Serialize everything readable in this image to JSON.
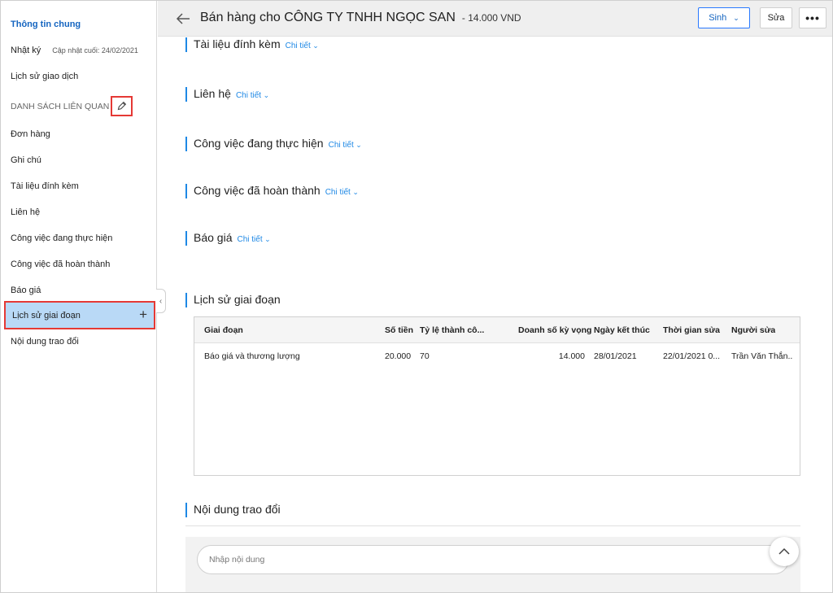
{
  "sidebar": {
    "items": [
      {
        "label": "Thông tin chung"
      },
      {
        "label": "Nhật ký",
        "sub": "Cập nhật cuối: 24/02/2021"
      },
      {
        "label": "Lịch sử giao dịch"
      },
      {
        "label": "Đơn hàng"
      },
      {
        "label": "Ghi chú"
      },
      {
        "label": "Tài liệu đính kèm"
      },
      {
        "label": "Liên hệ"
      },
      {
        "label": "Công việc đang thực hiện"
      },
      {
        "label": "Công việc đã hoàn thành"
      },
      {
        "label": "Báo giá"
      },
      {
        "label": "Lịch sử giai đoạn"
      },
      {
        "label": "Nội dung trao đổi"
      }
    ],
    "section_label": "DANH SÁCH LIÊN QUAN"
  },
  "header": {
    "title": "Bán hàng cho CÔNG TY TNHH NGỌC SAN",
    "amount": "- 14.000 VND",
    "sinh_label": "Sinh",
    "sua_label": "Sửa",
    "more_label": "•••"
  },
  "sections": {
    "detail_label": "Chi tiết",
    "tai_lieu": "Tài liệu đính kèm",
    "lien_he": "Liên hệ",
    "cv_dang": "Công việc đang thực hiện",
    "cv_da": "Công việc đã hoàn thành",
    "bao_gia": "Báo giá",
    "lich_su": "Lịch sử giai đoạn",
    "noi_dung": "Nội dung trao đổi"
  },
  "table": {
    "columns": [
      "Giai đoạn",
      "Số tiền",
      "Tỷ lệ thành cô...",
      "Doanh số kỳ vọng",
      "Ngày kết thúc",
      "Thời gian sửa",
      "Người sửa"
    ],
    "rows": [
      [
        "Báo giá và thương lượng",
        "20.000",
        "70",
        "14.000",
        "28/01/2021",
        "22/01/2021 0...",
        "Trần Văn Thắn..."
      ]
    ]
  },
  "comment": {
    "placeholder": "Nhập nội dung"
  },
  "colors": {
    "accent": "#1e88e5",
    "highlight": "#e53935",
    "active_bg": "#b9d9f6"
  }
}
